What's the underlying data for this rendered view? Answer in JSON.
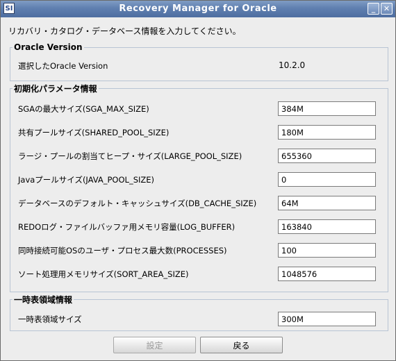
{
  "window": {
    "title": "Recovery Manager for Oracle",
    "app_icon_text": "SI",
    "minimize_label": "_",
    "close_label": "✕"
  },
  "intro_text": "リカバリ・カタログ・データベース情報を入力してください。",
  "oracle_version": {
    "title": "Oracle Version",
    "label": "選択したOracle Version",
    "value": "10.2.0"
  },
  "init_params": {
    "title": "初期化パラメータ情報",
    "rows": [
      {
        "label": "SGAの最大サイズ(SGA_MAX_SIZE)",
        "value": "384M"
      },
      {
        "label": "共有プールサイズ(SHARED_POOL_SIZE)",
        "value": "180M"
      },
      {
        "label": "ラージ・プールの割当てヒープ・サイズ(LARGE_POOL_SIZE)",
        "value": "655360"
      },
      {
        "label": "Javaプールサイズ(JAVA_POOL_SIZE)",
        "value": "0"
      },
      {
        "label": "データベースのデフォルト・キャッシュサイズ(DB_CACHE_SIZE)",
        "value": "64M"
      },
      {
        "label": "REDOログ・ファイルバッファ用メモリ容量(LOG_BUFFER)",
        "value": "163840"
      },
      {
        "label": "同時接続可能OSのユーザ・プロセス最大数(PROCESSES)",
        "value": "100"
      },
      {
        "label": "ソート処理用メモリサイズ(SORT_AREA_SIZE)",
        "value": "1048576"
      }
    ]
  },
  "temp_tablespace": {
    "title": "一時表領域情報",
    "label": "一時表領域サイズ",
    "value": "300M"
  },
  "buttons": {
    "set_label": "設定",
    "back_label": "戻る"
  }
}
